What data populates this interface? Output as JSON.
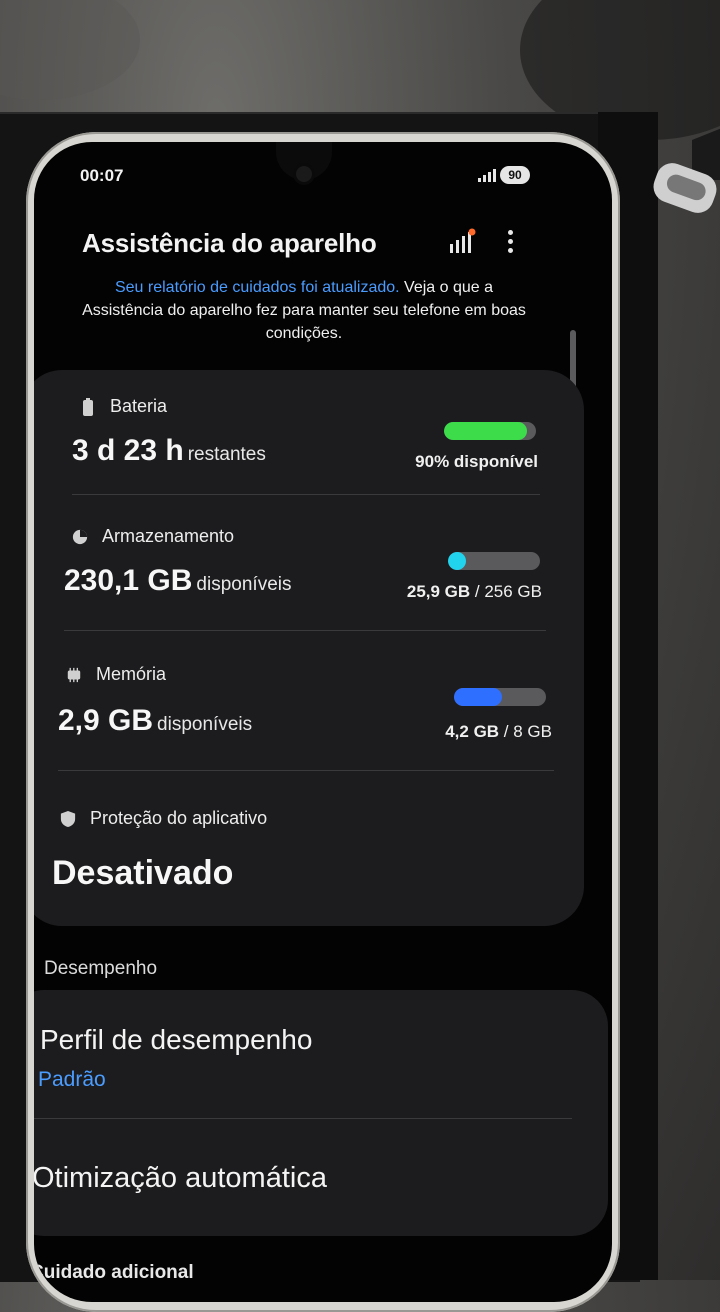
{
  "status_bar": {
    "time": "00:07",
    "battery": "90"
  },
  "header": {
    "title": "Assistência do aparelho"
  },
  "report": {
    "link_text": "Seu relatório de cuidados foi atualizado.",
    "text": " Veja o que a Assistência do aparelho fez para manter seu telefone em boas condições."
  },
  "battery": {
    "label": "Bateria",
    "value": "3 d 23 h",
    "suffix": "restantes",
    "status": "90% disponível",
    "level": 0.9,
    "color": "#3ddc4a"
  },
  "storage": {
    "label": "Armazenamento",
    "value": "230,1 GB",
    "suffix": "disponíveis",
    "used": "25,9 GB",
    "total": " / 256 GB",
    "level": 0.1,
    "color": "#22d3ee"
  },
  "memory": {
    "label": "Memória",
    "value": "2,9 GB",
    "suffix": "disponíveis",
    "used": "4,2 GB",
    "total": " / 8 GB",
    "level": 0.52,
    "color": "#2f6fff"
  },
  "protection": {
    "label": "Proteção do aplicativo",
    "value": "Desativado"
  },
  "performance": {
    "section": "Desempenho",
    "profile_title": "Perfil de desempenho",
    "profile_value": "Padrão",
    "optimization": "Otimização automática"
  },
  "extra_section": "Cuidado adicional"
}
